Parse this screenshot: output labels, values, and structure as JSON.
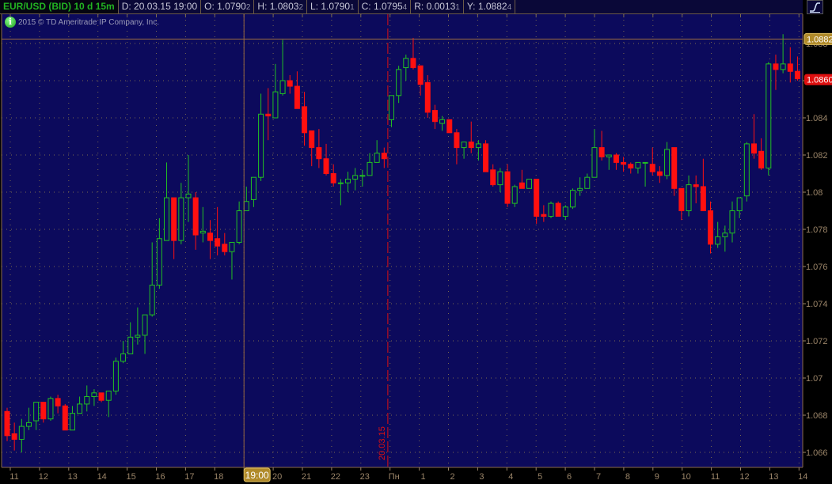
{
  "header": {
    "symbol": "EUR/USD (BID) 10 d 15m",
    "date": "D: 20.03.15 19:00",
    "open": {
      "main": "O: 1.0790",
      "pip": "2"
    },
    "high": {
      "main": "H: 1.0803",
      "pip": "2"
    },
    "low": {
      "main": "L: 1.0790",
      "pip": "1"
    },
    "close": {
      "main": "C: 1.0795",
      "pip": "4"
    },
    "range": {
      "main": "R: 0.0013",
      "pip": "1"
    },
    "last": {
      "main": "Y: 1.0882",
      "pip": "4"
    }
  },
  "copyright": "2015 © TD Ameritrade IP Company, Inc.",
  "icons": {
    "info": "info-icon",
    "study": "study-curve-icon"
  },
  "colors": {
    "background": "#0c0a5c",
    "up": "#22c022",
    "down": "#ff1010",
    "grid": "#7a6a50",
    "axis_text": "#9a8468",
    "last_price_box": "#b08a2a",
    "current_price_box": "#e01010"
  },
  "chart_data": {
    "type": "candlestick",
    "title": "EUR/USD (BID) 10 d 15m",
    "ylim": [
      1.065,
      1.0895
    ],
    "y_ticks": [
      "1.066",
      "1.068",
      "1.07",
      "1.072",
      "1.074",
      "1.076",
      "1.078",
      "1.08",
      "1.082",
      "1.084",
      "1.086",
      "1.088"
    ],
    "y_tick_values": [
      1.066,
      1.068,
      1.07,
      1.072,
      1.074,
      1.076,
      1.078,
      1.08,
      1.082,
      1.084,
      1.086,
      1.088
    ],
    "x_labels": [
      "11",
      "12",
      "13",
      "14",
      "15",
      "16",
      "17",
      "18",
      "19:00",
      "20",
      "21",
      "22",
      "23",
      "Пн",
      "1",
      "2",
      "3",
      "4",
      "5",
      "6",
      "7",
      "8",
      "9",
      "10",
      "11",
      "12",
      "13",
      "14"
    ],
    "highlighted_x_label": "19:00",
    "session_break_label": "20.03.15",
    "session_break_after_candle": 53,
    "cursor_candle": 34,
    "last_price_label": "1.0882",
    "last_price_value": 1.08824,
    "current_price_label": "1.0860",
    "current_price_value": 1.0861,
    "candles_ohlc": [
      [
        1.0682,
        1.0684,
        1.0666,
        1.0669
      ],
      [
        1.067,
        1.0676,
        1.0661,
        1.0667
      ],
      [
        1.0667,
        1.0678,
        1.066,
        1.0674
      ],
      [
        1.0674,
        1.0684,
        1.0672,
        1.0676
      ],
      [
        1.0677,
        1.0687,
        1.0672,
        1.0687
      ],
      [
        1.0687,
        1.0687,
        1.0676,
        1.0678
      ],
      [
        1.0678,
        1.069,
        1.0677,
        1.0689
      ],
      [
        1.0689,
        1.0691,
        1.0681,
        1.0685
      ],
      [
        1.0685,
        1.0686,
        1.0672,
        1.0672
      ],
      [
        1.0672,
        1.0685,
        1.0672,
        1.0681
      ],
      [
        1.0681,
        1.069,
        1.0681,
        1.0686
      ],
      [
        1.0686,
        1.0696,
        1.0682,
        1.069
      ],
      [
        1.069,
        1.0694,
        1.0685,
        1.0692
      ],
      [
        1.0692,
        1.0692,
        1.0687,
        1.0688
      ],
      [
        1.0688,
        1.0693,
        1.0679,
        1.0693
      ],
      [
        1.0693,
        1.0711,
        1.0691,
        1.0709
      ],
      [
        1.0709,
        1.072,
        1.0708,
        1.0713
      ],
      [
        1.0713,
        1.073,
        1.0713,
        1.0722
      ],
      [
        1.0722,
        1.0738,
        1.0718,
        1.0723
      ],
      [
        1.0723,
        1.0734,
        1.0713,
        1.0734
      ],
      [
        1.0734,
        1.0773,
        1.0733,
        1.075
      ],
      [
        1.075,
        1.0786,
        1.0748,
        1.0775
      ],
      [
        1.0774,
        1.0816,
        1.0774,
        1.0797
      ],
      [
        1.0797,
        1.0797,
        1.0764,
        1.0774
      ],
      [
        1.0774,
        1.0805,
        1.0772,
        1.0797
      ],
      [
        1.0797,
        1.082,
        1.0784,
        1.0799
      ],
      [
        1.0797,
        1.08,
        1.0769,
        1.0777
      ],
      [
        1.0778,
        1.0792,
        1.0773,
        1.0779
      ],
      [
        1.0778,
        1.0785,
        1.0764,
        1.0774
      ],
      [
        1.0775,
        1.0792,
        1.0766,
        1.0771
      ],
      [
        1.0772,
        1.0778,
        1.0766,
        1.0768
      ],
      [
        1.0768,
        1.0773,
        1.0753,
        1.0773
      ],
      [
        1.0773,
        1.0795,
        1.0772,
        1.079
      ],
      [
        1.079,
        1.0803,
        1.079,
        1.0795
      ],
      [
        1.0796,
        1.0808,
        1.0792,
        1.0808
      ],
      [
        1.0808,
        1.0853,
        1.0806,
        1.0842
      ],
      [
        1.0842,
        1.0856,
        1.0828,
        1.0841
      ],
      [
        1.084,
        1.0869,
        1.084,
        1.0854
      ],
      [
        1.0853,
        1.0882,
        1.0852,
        1.086
      ],
      [
        1.086,
        1.0863,
        1.0853,
        1.0857
      ],
      [
        1.0857,
        1.0865,
        1.0845,
        1.0845
      ],
      [
        1.0846,
        1.0854,
        1.0825,
        1.0832
      ],
      [
        1.0833,
        1.0833,
        1.0814,
        1.0824
      ],
      [
        1.0824,
        1.0834,
        1.0813,
        1.0818
      ],
      [
        1.0818,
        1.0826,
        1.0809,
        1.081
      ],
      [
        1.081,
        1.0815,
        1.0803,
        1.0805
      ],
      [
        1.0805,
        1.0807,
        1.0793,
        1.0805
      ],
      [
        1.0805,
        1.0811,
        1.08,
        1.0807
      ],
      [
        1.0807,
        1.0813,
        1.0801,
        1.0809
      ],
      [
        1.0809,
        1.0812,
        1.0803,
        1.0809
      ],
      [
        1.0809,
        1.0821,
        1.0809,
        1.0816
      ],
      [
        1.0816,
        1.0828,
        1.0816,
        1.0821
      ],
      [
        1.0821,
        1.0824,
        1.0813,
        1.0818
      ],
      [
        1.0839,
        1.0852,
        1.0835,
        1.0852
      ],
      [
        1.0852,
        1.0868,
        1.0848,
        1.0866
      ],
      [
        1.0867,
        1.0874,
        1.086,
        1.0872
      ],
      [
        1.0872,
        1.0883,
        1.0866,
        1.0867
      ],
      [
        1.0868,
        1.0868,
        1.0852,
        1.0858
      ],
      [
        1.0859,
        1.0863,
        1.084,
        1.0843
      ],
      [
        1.0844,
        1.0847,
        1.0834,
        1.0838
      ],
      [
        1.0837,
        1.0841,
        1.0833,
        1.0839
      ],
      [
        1.0839,
        1.0839,
        1.0832,
        1.0832
      ],
      [
        1.0832,
        1.0834,
        1.0815,
        1.0824
      ],
      [
        1.0824,
        1.0827,
        1.0818,
        1.0827
      ],
      [
        1.0827,
        1.0838,
        1.0821,
        1.0824
      ],
      [
        1.0824,
        1.0828,
        1.0817,
        1.0826
      ],
      [
        1.0826,
        1.0828,
        1.0811,
        1.0811
      ],
      [
        1.0812,
        1.0815,
        1.0803,
        1.0804
      ],
      [
        1.0804,
        1.0813,
        1.08,
        1.0811
      ],
      [
        1.0811,
        1.0815,
        1.0792,
        1.0794
      ],
      [
        1.0794,
        1.0804,
        1.0792,
        1.0803
      ],
      [
        1.0805,
        1.0812,
        1.0802,
        1.0802
      ],
      [
        1.0802,
        1.0807,
        1.0802,
        1.0807
      ],
      [
        1.0807,
        1.0807,
        1.0783,
        1.0787
      ],
      [
        1.0788,
        1.0793,
        1.0784,
        1.0787
      ],
      [
        1.0787,
        1.0795,
        1.0786,
        1.0794
      ],
      [
        1.0794,
        1.0795,
        1.0787,
        1.0787
      ],
      [
        1.0787,
        1.0793,
        1.0785,
        1.0792
      ],
      [
        1.0792,
        1.0802,
        1.0791,
        1.0801
      ],
      [
        1.0801,
        1.0808,
        1.0798,
        1.0802
      ],
      [
        1.0802,
        1.081,
        1.0802,
        1.0808
      ],
      [
        1.0808,
        1.0834,
        1.0808,
        1.0824
      ],
      [
        1.0824,
        1.0833,
        1.0817,
        1.0819
      ],
      [
        1.0819,
        1.082,
        1.0812,
        1.082
      ],
      [
        1.082,
        1.0821,
        1.0812,
        1.0816
      ],
      [
        1.0816,
        1.0819,
        1.0811,
        1.0815
      ],
      [
        1.0815,
        1.0816,
        1.081,
        1.0813
      ],
      [
        1.0813,
        1.0816,
        1.081,
        1.0816
      ],
      [
        1.0816,
        1.0816,
        1.0803,
        1.0816
      ],
      [
        1.0815,
        1.0824,
        1.0809,
        1.0811
      ],
      [
        1.0811,
        1.0814,
        1.0805,
        1.0809
      ],
      [
        1.0809,
        1.0827,
        1.0807,
        1.0823
      ],
      [
        1.0824,
        1.0824,
        1.0798,
        1.0802
      ],
      [
        1.0802,
        1.0802,
        1.0785,
        1.079
      ],
      [
        1.079,
        1.0809,
        1.0787,
        1.0804
      ],
      [
        1.0804,
        1.0809,
        1.0794,
        1.0803
      ],
      [
        1.0803,
        1.0818,
        1.079,
        1.079
      ],
      [
        1.079,
        1.0795,
        1.0767,
        1.0772
      ],
      [
        1.0772,
        1.0784,
        1.077,
        1.0776
      ],
      [
        1.0776,
        1.0782,
        1.0768,
        1.0778
      ],
      [
        1.0778,
        1.0795,
        1.0773,
        1.079
      ],
      [
        1.079,
        1.0797,
        1.0786,
        1.0797
      ],
      [
        1.0798,
        1.0827,
        1.0795,
        1.0826
      ],
      [
        1.0826,
        1.0842,
        1.0818,
        1.0821
      ],
      [
        1.0822,
        1.0829,
        1.0812,
        1.0813
      ],
      [
        1.0813,
        1.087,
        1.0809,
        1.0869
      ],
      [
        1.0869,
        1.0874,
        1.0855,
        1.0866
      ],
      [
        1.0866,
        1.0885,
        1.0864,
        1.0869
      ],
      [
        1.0869,
        1.0878,
        1.0859,
        1.0865
      ],
      [
        1.0865,
        1.0873,
        1.086,
        1.0861
      ]
    ]
  }
}
